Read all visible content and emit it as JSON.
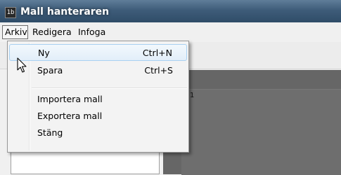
{
  "window": {
    "title": "Mall hanteraren",
    "icon": "app-icon",
    "icon_glyph": "1b"
  },
  "menubar": {
    "items": [
      "Arkiv",
      "Redigera",
      "Infoga"
    ]
  },
  "dropdown": {
    "items": [
      {
        "label": "Ny",
        "shortcut": "Ctrl+N",
        "highlighted": true
      },
      {
        "label": "Spara",
        "shortcut": "Ctrl+S"
      },
      {
        "label": "Importera mall",
        "shortcut": ""
      },
      {
        "label": "Exportera mall",
        "shortcut": ""
      },
      {
        "label": "Stäng",
        "shortcut": ""
      }
    ]
  },
  "canvas": {
    "label": "1"
  },
  "colors": {
    "menu_hover_border": "#a8d1f2",
    "canvas_bg": "#666666"
  }
}
